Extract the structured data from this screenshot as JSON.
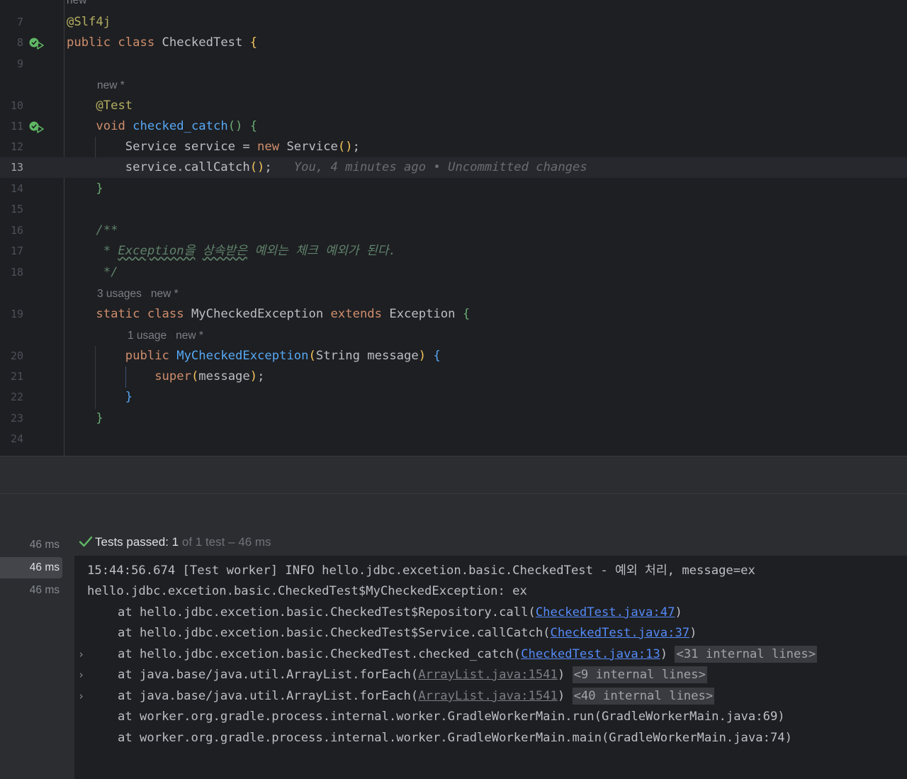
{
  "editor": {
    "top_hint": "new *",
    "lines": [
      {
        "n": "7",
        "code": [
          {
            "c": "ann",
            "t": "@Slf4j"
          }
        ]
      },
      {
        "n": "8",
        "run": true,
        "code": [
          {
            "c": "kw",
            "t": "public class "
          },
          {
            "c": "",
            "t": "CheckedTest "
          },
          {
            "c": "br1",
            "t": "{"
          }
        ]
      },
      {
        "n": "9",
        "code": []
      },
      {
        "n": "10",
        "hint": "new *",
        "code": [
          {
            "c": "",
            "t": "    "
          },
          {
            "c": "ann",
            "t": "@Test"
          }
        ]
      },
      {
        "n": "11",
        "run": true,
        "code": [
          {
            "c": "",
            "t": "    "
          },
          {
            "c": "kw",
            "t": "void "
          },
          {
            "c": "fn",
            "t": "checked_catch"
          },
          {
            "c": "br2",
            "t": "() {"
          }
        ]
      },
      {
        "n": "12",
        "code": [
          {
            "c": "",
            "t": "        Service service = "
          },
          {
            "c": "kw",
            "t": "new "
          },
          {
            "c": "",
            "t": "Service"
          },
          {
            "c": "br1",
            "t": "()"
          },
          {
            "c": "",
            "t": ";"
          }
        ]
      },
      {
        "n": "13",
        "current": true,
        "code": [
          {
            "c": "",
            "t": "        service.callCatch"
          },
          {
            "c": "br1",
            "t": "()"
          },
          {
            "c": "",
            "t": ";   "
          },
          {
            "c": "blame",
            "t": "You, 4 minutes ago • Uncommitted changes"
          }
        ]
      },
      {
        "n": "14",
        "code": [
          {
            "c": "",
            "t": "    "
          },
          {
            "c": "br2",
            "t": "}"
          }
        ]
      },
      {
        "n": "15",
        "code": []
      },
      {
        "n": "16",
        "code": [
          {
            "c": "",
            "t": "    "
          },
          {
            "c": "doc",
            "t": "/**"
          }
        ]
      },
      {
        "n": "17",
        "code": [
          {
            "c": "",
            "t": "     "
          },
          {
            "c": "doc",
            "t": "* "
          },
          {
            "c": "doc wavy",
            "t": "Exception을"
          },
          {
            "c": "doc",
            "t": " "
          },
          {
            "c": "doc wavy",
            "t": "상속받은"
          },
          {
            "c": "doc",
            "t": " 예외는 체크 예외가 된다."
          }
        ]
      },
      {
        "n": "18",
        "code": [
          {
            "c": "",
            "t": "     "
          },
          {
            "c": "doc",
            "t": "*/"
          }
        ]
      },
      {
        "n": "19",
        "hint": "3 usages   new *",
        "code": [
          {
            "c": "",
            "t": "    "
          },
          {
            "c": "kw",
            "t": "static class "
          },
          {
            "c": "",
            "t": "MyCheckedException "
          },
          {
            "c": "kw",
            "t": "extends "
          },
          {
            "c": "",
            "t": "Exception "
          },
          {
            "c": "br2",
            "t": "{"
          }
        ]
      },
      {
        "n": "20",
        "hint": "1 usage   new *",
        "code": [
          {
            "c": "",
            "t": "        "
          },
          {
            "c": "kw",
            "t": "public "
          },
          {
            "c": "fn",
            "t": "MyCheckedException"
          },
          {
            "c": "br1",
            "t": "("
          },
          {
            "c": "",
            "t": "String message"
          },
          {
            "c": "br1",
            "t": ")"
          },
          {
            "c": "",
            "t": " "
          },
          {
            "c": "br3",
            "t": "{"
          }
        ]
      },
      {
        "n": "21",
        "code": [
          {
            "c": "",
            "t": "            "
          },
          {
            "c": "kw",
            "t": "super"
          },
          {
            "c": "br1",
            "t": "("
          },
          {
            "c": "",
            "t": "message"
          },
          {
            "c": "br1",
            "t": ")"
          },
          {
            "c": "",
            "t": ";"
          }
        ]
      },
      {
        "n": "22",
        "code": [
          {
            "c": "",
            "t": "        "
          },
          {
            "c": "br3",
            "t": "}"
          }
        ]
      },
      {
        "n": "23",
        "code": [
          {
            "c": "",
            "t": "    "
          },
          {
            "c": "br2",
            "t": "}"
          }
        ]
      },
      {
        "n": "24",
        "code": []
      }
    ]
  },
  "tests": {
    "status_label": "Tests passed: ",
    "passed": "1",
    "status_rest": " of 1 test – 46 ms",
    "durations": [
      "46 ms",
      "46 ms",
      "46 ms"
    ]
  },
  "console": {
    "lines": [
      {
        "ind": false,
        "parts": [
          {
            "c": "",
            "t": "15:44:56.674 [Test worker] INFO hello.jdbc.excetion.basic.CheckedTest - 예외 처리, message=ex"
          }
        ]
      },
      {
        "ind": false,
        "parts": [
          {
            "c": "",
            "t": "hello.jdbc.excetion.basic.CheckedTest$MyCheckedException: ex"
          }
        ]
      },
      {
        "ind": true,
        "parts": [
          {
            "c": "",
            "t": "at hello.jdbc.excetion.basic.CheckedTest$Repository.call("
          },
          {
            "c": "link",
            "t": "CheckedTest.java:47"
          },
          {
            "c": "",
            "t": ")"
          }
        ]
      },
      {
        "ind": true,
        "parts": [
          {
            "c": "",
            "t": "at hello.jdbc.excetion.basic.CheckedTest$Service.callCatch("
          },
          {
            "c": "link",
            "t": "CheckedTest.java:37"
          },
          {
            "c": "",
            "t": ")"
          }
        ]
      },
      {
        "ind": true,
        "chevron": true,
        "parts": [
          {
            "c": "",
            "t": "at hello.jdbc.excetion.basic.CheckedTest.checked_catch("
          },
          {
            "c": "link",
            "t": "CheckedTest.java:13"
          },
          {
            "c": "",
            "t": ") "
          },
          {
            "c": "folded",
            "t": "<31 internal lines>"
          }
        ]
      },
      {
        "ind": true,
        "chevron": true,
        "parts": [
          {
            "c": "",
            "t": "at java.base/java.util.ArrayList.forEach("
          },
          {
            "c": "link2",
            "t": "ArrayList.java:1541"
          },
          {
            "c": "",
            "t": ") "
          },
          {
            "c": "folded",
            "t": "<9 internal lines>"
          }
        ]
      },
      {
        "ind": true,
        "chevron": true,
        "parts": [
          {
            "c": "",
            "t": "at java.base/java.util.ArrayList.forEach("
          },
          {
            "c": "link2",
            "t": "ArrayList.java:1541"
          },
          {
            "c": "",
            "t": ") "
          },
          {
            "c": "folded",
            "t": "<40 internal lines>"
          }
        ]
      },
      {
        "ind": true,
        "parts": [
          {
            "c": "",
            "t": "at worker.org.gradle.process.internal.worker.GradleWorkerMain.run(GradleWorkerMain.java:69)"
          }
        ]
      },
      {
        "ind": true,
        "parts": [
          {
            "c": "",
            "t": "at worker.org.gradle.process.internal.worker.GradleWorkerMain.main(GradleWorkerMain.java:74)"
          }
        ]
      }
    ]
  }
}
